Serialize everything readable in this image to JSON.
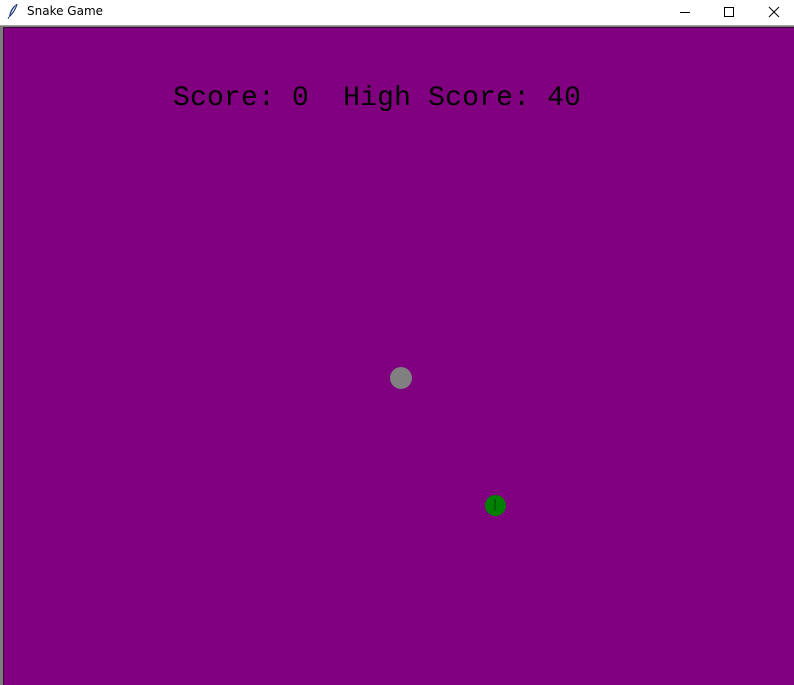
{
  "window": {
    "title": "Snake Game",
    "icons": {
      "app": "feather-icon",
      "minimize": "minimize-icon",
      "maximize": "maximize-icon",
      "close": "close-icon"
    }
  },
  "game": {
    "score_label": "Score:",
    "score_value": "0",
    "high_score_label": "High Score:",
    "high_score_value": "40",
    "colors": {
      "background": "#800080",
      "food": "#808080",
      "snake": "#008000",
      "text": "#000000"
    }
  }
}
